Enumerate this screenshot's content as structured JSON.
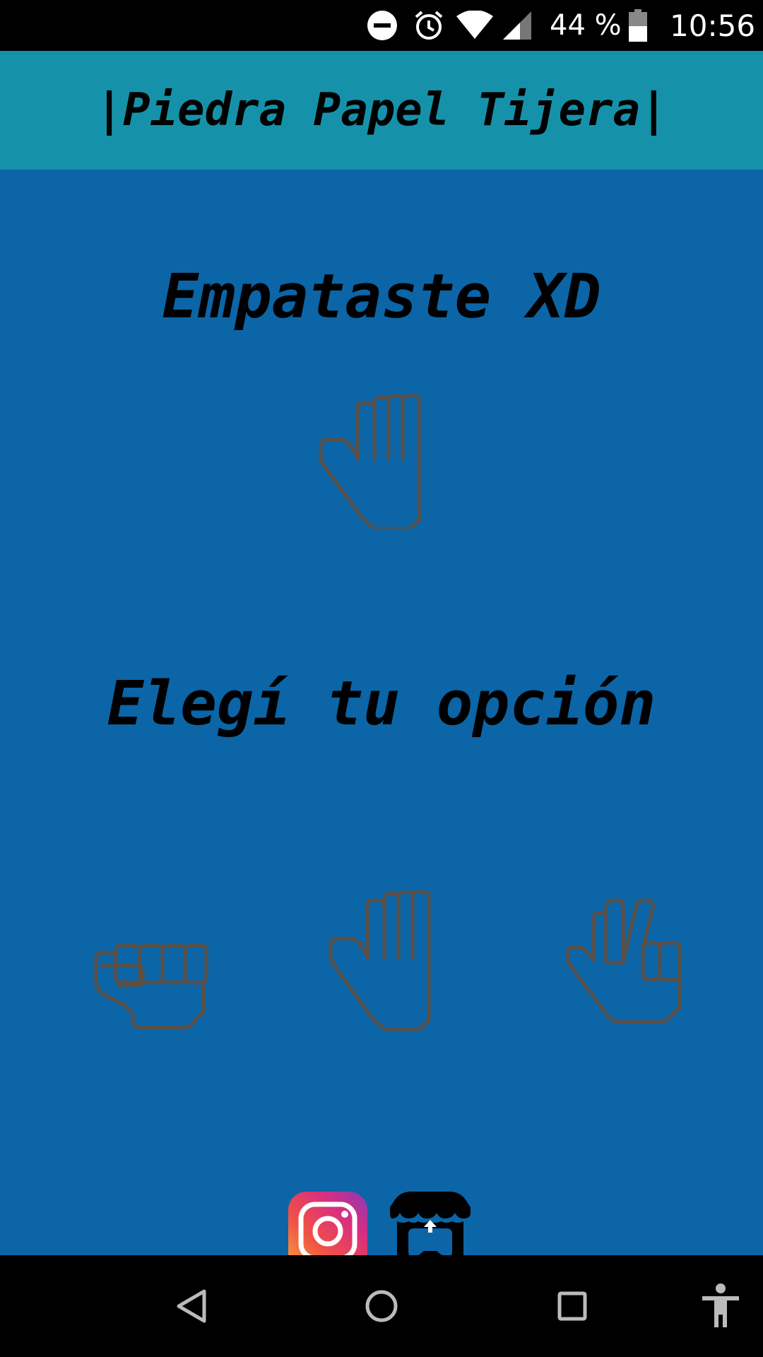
{
  "status_bar": {
    "battery_percent": "44 %",
    "time": "10:56",
    "icons": [
      "do-not-disturb-icon",
      "alarm-icon",
      "wifi-icon",
      "signal-icon",
      "battery-icon"
    ]
  },
  "app_bar": {
    "title": "|Piedra Papel Tijera|",
    "background": "#1592A9"
  },
  "main": {
    "background": "#0B65A7",
    "result_text": "Empataste XD",
    "result_hand": "paper-hand-icon",
    "prompt_text": "Elegí tu opción",
    "choices": [
      {
        "name": "rock",
        "icon": "rock-hand-icon"
      },
      {
        "name": "paper",
        "icon": "paper-hand-icon"
      },
      {
        "name": "scissors",
        "icon": "scissors-hand-icon"
      }
    ],
    "social_links": [
      {
        "icon": "instagram-icon"
      },
      {
        "icon": "itch-io-icon"
      }
    ]
  },
  "nav_bar": {
    "buttons": [
      "back-icon",
      "home-icon",
      "recents-icon",
      "accessibility-icon"
    ]
  }
}
